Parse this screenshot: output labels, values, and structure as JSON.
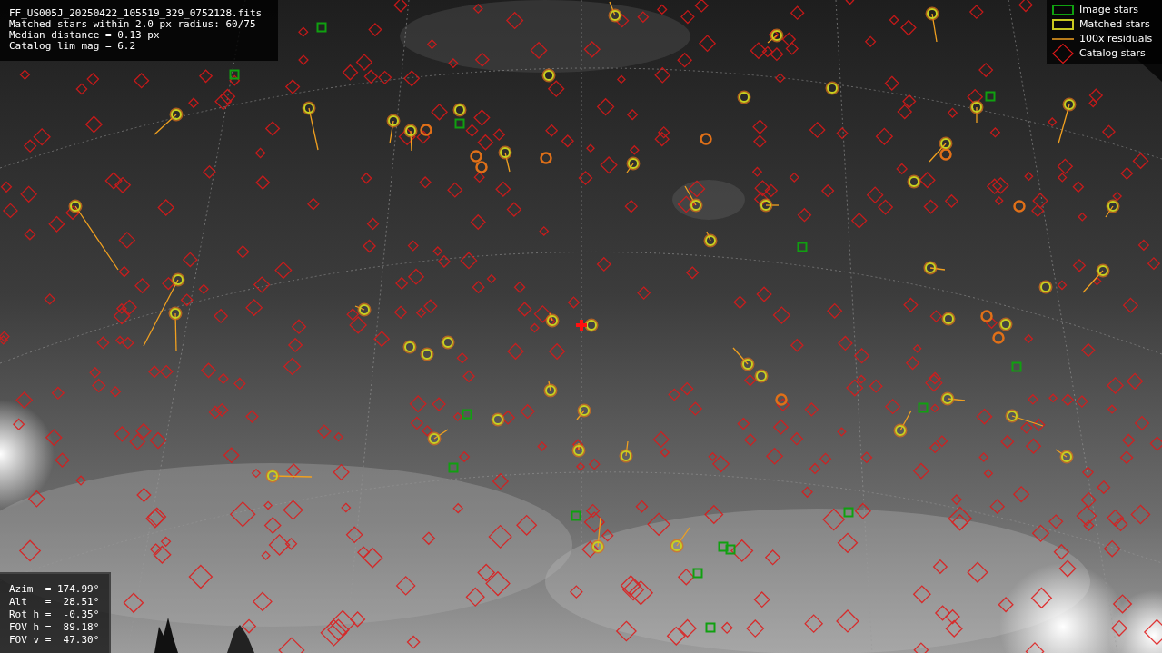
{
  "info": {
    "file": "FF_US005J_20250422_105519_329_0752128.fits",
    "lines": [
      "Matched stars within 2.0 px radius: 60/75",
      "Median distance = 0.13 px",
      "Catalog lim mag = 6.2"
    ]
  },
  "legend": [
    {
      "label": "Image stars"
    },
    {
      "kind": "matched",
      "label": "Matched stars"
    },
    {
      "kind": "residual",
      "label": "100x residuals"
    },
    {
      "kind": "catalog",
      "label": "Catalog stars"
    }
  ],
  "pointing": [
    "Azim  = 174.99°",
    "Alt   =  28.51°",
    "Rot h =  -0.35°",
    "FOV h =  89.18°",
    "FOV v =  47.30°"
  ]
}
